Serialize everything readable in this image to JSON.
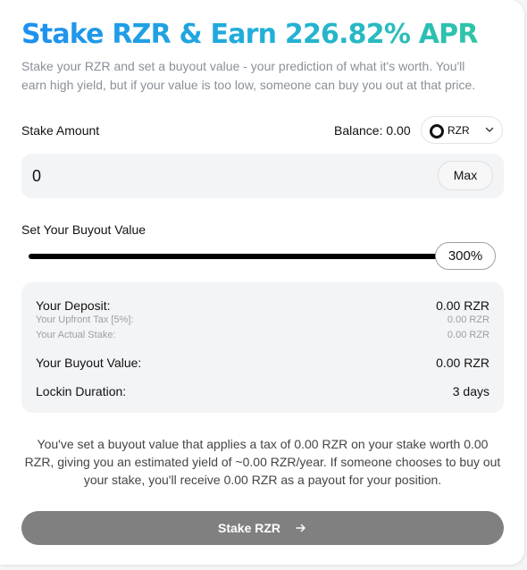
{
  "header": {
    "title": "Stake RZR & Earn 226.82% APR",
    "subtitle": "Stake your RZR and set a buyout value - your prediction of what it's worth. You'll earn high yield, but if your value is too low, someone can buy you out at that price."
  },
  "stake": {
    "label": "Stake Amount",
    "balance_text": "Balance: 0.00",
    "token": "RZR",
    "amount_value": "0",
    "max_label": "Max"
  },
  "buyout": {
    "label": "Set Your Buyout Value",
    "slider_percent_text": "300%",
    "slider_fill_fraction": 1.0
  },
  "summary": {
    "deposit_label": "Your Deposit:",
    "deposit_value": "0.00 RZR",
    "tax_label": "Your Upfront Tax [5%]:",
    "tax_value": "0.00 RZR",
    "actual_stake_label": "Your Actual Stake:",
    "actual_stake_value": "0.00 RZR",
    "buyout_label": "Your Buyout Value:",
    "buyout_value": "0.00 RZR",
    "lockin_label": "Lockin Duration:",
    "lockin_value": "3 days"
  },
  "note": "You've set a buyout value that applies a tax of 0.00 RZR on your stake worth 0.00 RZR, giving you an estimated yield of ~0.00 RZR/year. If someone chooses to buy out your stake, you'll receive 0.00 RZR as a payout for your position.",
  "action": {
    "stake_label": "Stake RZR",
    "arrow_icon": "arrow-right-icon"
  },
  "colors": {
    "title_gradient_start": "#1e90f0",
    "title_gradient_end": "#2ec4a8",
    "button_disabled": "#808080"
  }
}
